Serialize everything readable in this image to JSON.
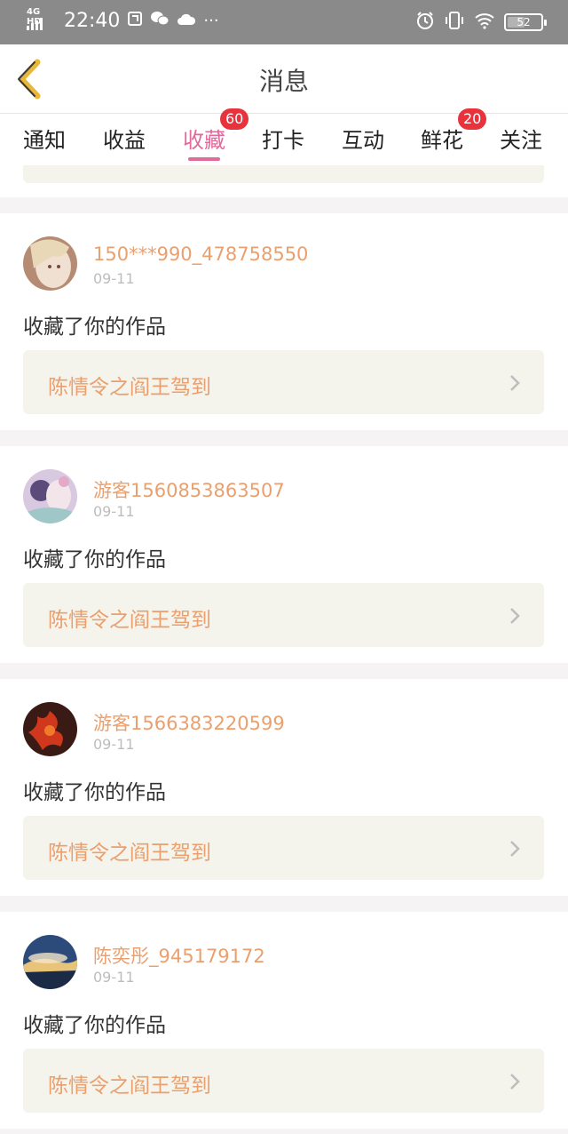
{
  "status_bar": {
    "network": "4G HD",
    "time": "22:40",
    "notification_icons": [
      "sim-icon",
      "wechat-icon",
      "cloud-icon",
      "more-dots"
    ],
    "more": "···",
    "battery": "52",
    "battery_level_percent": 52
  },
  "nav": {
    "title": "消息"
  },
  "tabs": [
    {
      "label": "通知",
      "badge": ""
    },
    {
      "label": "收益",
      "badge": ""
    },
    {
      "label": "收藏",
      "badge": "60",
      "active": true
    },
    {
      "label": "打卡",
      "badge": ""
    },
    {
      "label": "互动",
      "badge": ""
    },
    {
      "label": "鲜花",
      "badge": "20"
    },
    {
      "label": "关注",
      "badge": ""
    }
  ],
  "messages": [
    {
      "user": "150***990_478758550",
      "date": "09-11",
      "action": "收藏了你的作品",
      "work": "陈情令之阎王驾到",
      "avatar": "anime-avatar-1"
    },
    {
      "user": "游客1560853863507",
      "date": "09-11",
      "action": "收藏了你的作品",
      "work": "陈情令之阎王驾到",
      "avatar": "anime-avatar-2"
    },
    {
      "user": "游客1566383220599",
      "date": "09-11",
      "action": "收藏了你的作品",
      "work": "陈情令之阎王驾到",
      "avatar": "flower-avatar"
    },
    {
      "user": "陈奕彤_945179172",
      "date": "09-11",
      "action": "收藏了你的作品",
      "work": "陈情令之阎王驾到",
      "avatar": "sky-avatar"
    }
  ],
  "colors": {
    "accent_pink": "#e06a9a",
    "username_orange": "#eaa06e",
    "badge_red": "#e8323c",
    "back_arrow": "#e8b83a",
    "link_bg": "#f4f3ec"
  }
}
